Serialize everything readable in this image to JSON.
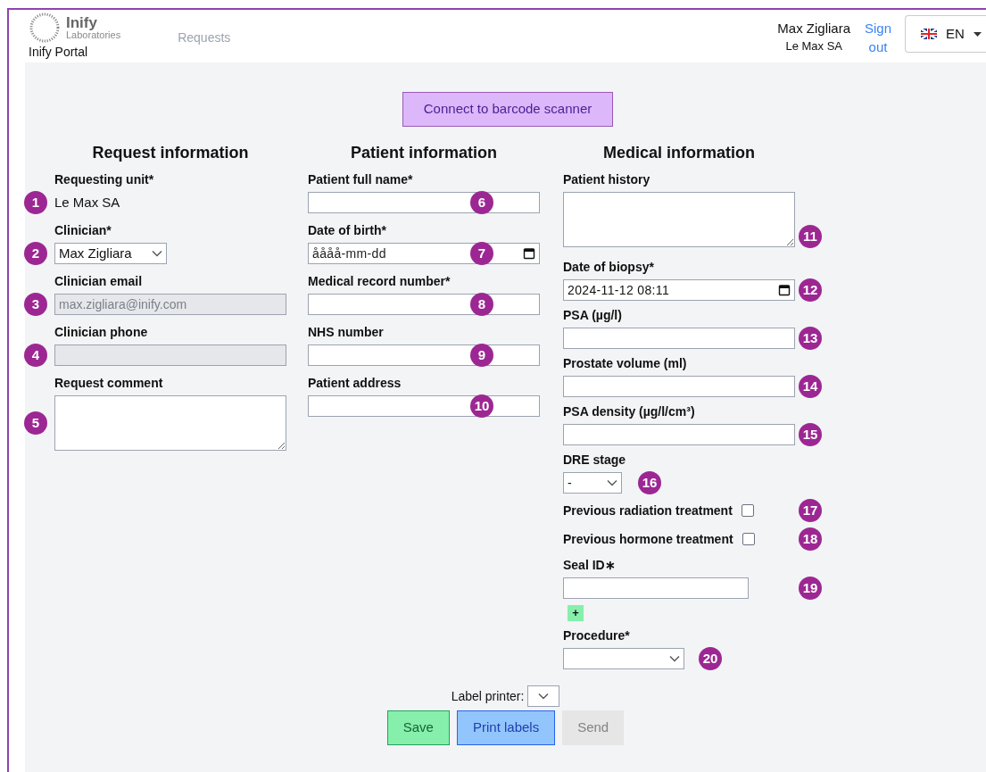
{
  "header": {
    "logo_name": "Inify",
    "logo_subtitle": "Laboratories",
    "portal_title": "Inify Portal",
    "nav": [
      {
        "label": "Requests",
        "selected": false
      }
    ],
    "user_name": "Max Zigliara",
    "user_org": "Le Max SA",
    "sign_out": "Sign out",
    "language": "EN"
  },
  "barcode_button": "Connect to barcode scanner",
  "sections": [
    {
      "title": "Request information",
      "fields": [
        {
          "kind": "static",
          "label": "Requesting unit*",
          "value": "Le Max SA",
          "marker": "1"
        },
        {
          "kind": "select",
          "label": "Clinician*",
          "value": "Max Zigliara",
          "marker": "2"
        },
        {
          "kind": "text",
          "label": "Clinician email",
          "value": "max.zigliara@inify.com",
          "disabled": true,
          "marker": "3"
        },
        {
          "kind": "text",
          "label": "Clinician phone",
          "disabled": true,
          "marker": "4"
        },
        {
          "kind": "textarea",
          "label": "Request comment",
          "marker": "5"
        }
      ]
    },
    {
      "title": "Patient information",
      "fields": [
        {
          "kind": "text",
          "label": "Patient full name*",
          "disabled": false,
          "marker": "6"
        },
        {
          "kind": "date",
          "label": "Date of birth*",
          "placeholder": "åååå-mm-dd",
          "marker": "7"
        },
        {
          "kind": "text",
          "label": "Medical record number*",
          "disabled": false,
          "marker": "8"
        },
        {
          "kind": "text",
          "label": "NHS number",
          "disabled": false,
          "marker": "9"
        },
        {
          "kind": "text",
          "label": "Patient address",
          "disabled": false,
          "marker": "10"
        }
      ]
    },
    {
      "title": "Medical information",
      "fields": [
        {
          "kind": "textarea",
          "label": "Patient history",
          "marker": "11"
        },
        {
          "kind": "date",
          "label": "Date of biopsy*",
          "value": "2024-11-12 08:11",
          "marker": "12"
        },
        {
          "kind": "text",
          "label": "PSA (µg/l)",
          "disabled": false,
          "marker": "13"
        },
        {
          "kind": "text",
          "label": "Prostate volume (ml)",
          "disabled": false,
          "marker": "14"
        },
        {
          "kind": "text",
          "label": "PSA density (µg/l/cm³)",
          "disabled": false,
          "marker": "15"
        },
        {
          "kind": "select",
          "label": "DRE stage",
          "value": "-",
          "marker": "16"
        },
        {
          "kind": "checkbox",
          "label": "Previous radiation treatment",
          "checked": false,
          "marker": "17"
        },
        {
          "kind": "checkbox",
          "label": "Previous hormone treatment",
          "checked": false,
          "marker": "18"
        },
        {
          "kind": "seal",
          "label": "Seal ID∗",
          "add": "+",
          "marker": "19"
        },
        {
          "kind": "select",
          "label": "Procedure*",
          "marker": "20"
        }
      ]
    }
  ],
  "label_printer": {
    "label": "Label printer:"
  },
  "actions": [
    {
      "label": "Save",
      "kind": "save",
      "disabled": false
    },
    {
      "label": "Print labels",
      "kind": "print",
      "disabled": false
    },
    {
      "label": "Send",
      "kind": "send",
      "disabled": true
    }
  ]
}
